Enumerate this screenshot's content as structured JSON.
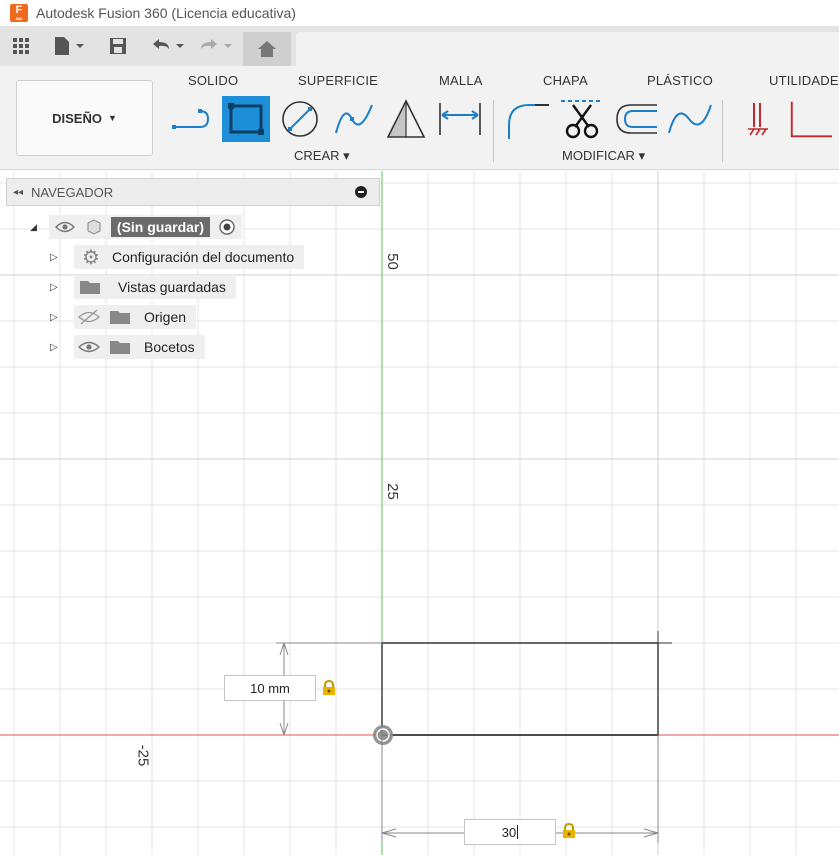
{
  "window": {
    "title": "Autodesk Fusion 360 (Licencia educativa)",
    "logo_letter": "F",
    "logo_sub": "360"
  },
  "qat": {
    "icons": [
      "grid-icon",
      "file-icon",
      "save-icon",
      "undo-icon",
      "redo-icon",
      "home-icon"
    ]
  },
  "ribbon": {
    "tabs": [
      "SOLIDO",
      "SUPERFICIE",
      "MALLA",
      "CHAPA",
      "PLÁSTICO",
      "UTILIDADES"
    ],
    "workspace": "DISEÑO",
    "panels": {
      "create": "CREAR",
      "modify": "MODIFICAR"
    },
    "create_tools": [
      "line-tool-icon",
      "rectangle-tool-icon",
      "circle-tool-icon",
      "spline-tool-icon",
      "triangle-tool-icon",
      "dimension-tool-icon"
    ],
    "modify_tools": [
      "fillet-tool-icon",
      "trim-tool-icon",
      "offset-tool-icon",
      "curve-tool-icon"
    ],
    "constraint_tools": [
      "horizontal-constraint-icon",
      "perpendicular-constraint-icon"
    ],
    "accent": "#1d8fd8"
  },
  "navigator": {
    "title": "NAVEGADOR",
    "root": "(Sin guardar)",
    "items": [
      {
        "label": "Configuración del documento",
        "icon": "gear-icon"
      },
      {
        "label": "Vistas guardadas",
        "icon": "folder-icon"
      },
      {
        "label": "Origen",
        "icon": "folder-icon",
        "hidden": true
      },
      {
        "label": "Bocetos",
        "icon": "folder-icon"
      }
    ]
  },
  "canvas": {
    "axis_labels": {
      "y50": "50",
      "y25": "25",
      "xneg25": "-25"
    },
    "dimensions": {
      "height_value": "10 mm",
      "width_value": "30"
    },
    "colors": {
      "x_axis": "#e05050",
      "y_axis": "#5cc05c",
      "grid": "#e6e6e6",
      "sketch": "#333333"
    }
  }
}
